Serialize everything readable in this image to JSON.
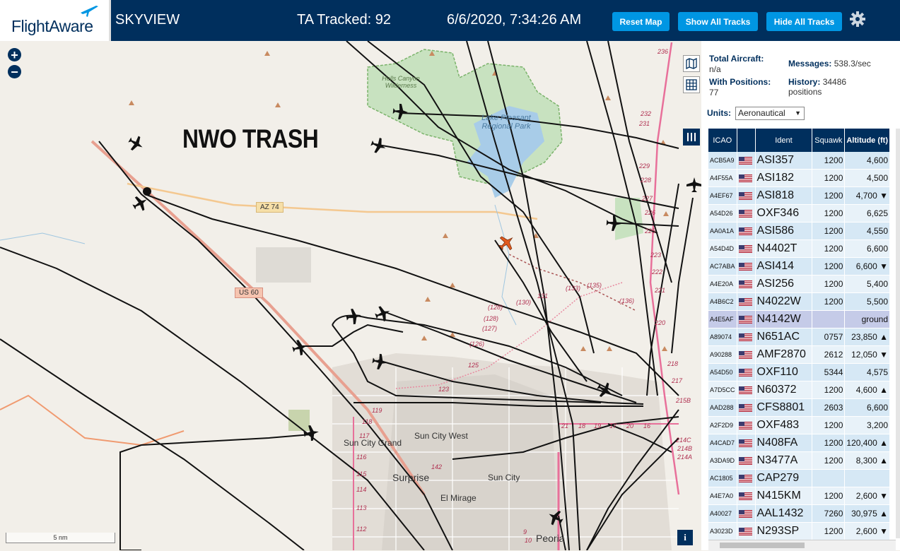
{
  "header": {
    "logo_text": "FlightAware",
    "app_title": "SKYVIEW",
    "tracked_label": "TA Tracked: 92",
    "datetime": "6/6/2020, 7:34:26 AM",
    "buttons": {
      "reset_map": "Reset Map",
      "show_all": "Show All Tracks",
      "hide_all": "Hide All Tracks"
    },
    "colors": {
      "bar": "#002f5d",
      "button": "#0096e3"
    }
  },
  "map": {
    "overlay_text": "NWO TRASH",
    "zoom_in": "+",
    "zoom_out": "−",
    "scale_label": "5 nm",
    "info_button": "i",
    "places": {
      "hells_canyon": "Hells Canyon Wilderness",
      "lake_pleasant": "Lake Pleasant Regional Park",
      "az74": "AZ 74",
      "us60": "US 60",
      "sun_city_grand": "Sun City Grand",
      "sun_city_west": "Sun City West",
      "surprise": "Surprise",
      "sun_city": "Sun City",
      "el_mirage": "El Mirage",
      "peoria": "Peoria"
    },
    "route_labels": {
      "r236": "236",
      "r232": "232",
      "r231": "231",
      "r229": "229",
      "r228": "228",
      "r227": "227",
      "r226": "226",
      "r225": "225",
      "r223": "223",
      "r222": "222",
      "r221": "221",
      "r220": "220",
      "r218": "218",
      "r217": "217",
      "r215b": "215B",
      "r214c": "214C",
      "r214b": "214B",
      "r214a": "214A",
      "r136": "(136)",
      "r135": "(135)",
      "r133": "(133)",
      "r131": "131",
      "r130": "(130)",
      "r128a": "(128)",
      "r128b": "(128)",
      "r127": "(127)",
      "r126": "(126)",
      "r125": "125",
      "r123": "123",
      "r119": "119",
      "r118": "118",
      "r117": "117",
      "r116": "116",
      "r115": "115",
      "r114": "114",
      "r113": "113",
      "r112": "112",
      "s21": "21",
      "s20": "20",
      "s19": "19",
      "s18": "18",
      "s17": "17",
      "s16": "16",
      "r142": "142",
      "s9": "9",
      "s10": "10"
    },
    "tool_icons": [
      "map-icon",
      "grid-icon",
      "columns-icon"
    ]
  },
  "panel": {
    "total_aircraft_label": "Total Aircraft:",
    "total_aircraft_value": "n/a",
    "messages_label": "Messages:",
    "messages_value": "538.3/sec",
    "with_positions_label": "With Positions:",
    "with_positions_value": "77",
    "history_label": "History:",
    "history_value": "34486 positions",
    "units_label": "Units:",
    "units_value": "Aeronautical",
    "columns": [
      "ICAO",
      "",
      "Ident",
      "Squawk",
      "Altitude (ft)"
    ],
    "rows": [
      {
        "icao": "ACB5A9",
        "ident": "ASI357",
        "squawk": "1200",
        "altitude": "4,600"
      },
      {
        "icao": "A4F55A",
        "ident": "ASI182",
        "squawk": "1200",
        "altitude": "4,500"
      },
      {
        "icao": "A4EF67",
        "ident": "ASI818",
        "squawk": "1200",
        "altitude": "4,700 ▼"
      },
      {
        "icao": "A54D26",
        "ident": "OXF346",
        "squawk": "1200",
        "altitude": "6,625"
      },
      {
        "icao": "AA0A1A",
        "ident": "ASI586",
        "squawk": "1200",
        "altitude": "4,550"
      },
      {
        "icao": "A54D4D",
        "ident": "N4402T",
        "squawk": "1200",
        "altitude": "6,600"
      },
      {
        "icao": "AC7ABA",
        "ident": "ASI414",
        "squawk": "1200",
        "altitude": "6,600 ▼"
      },
      {
        "icao": "A4E20A",
        "ident": "ASI256",
        "squawk": "1200",
        "altitude": "5,400"
      },
      {
        "icao": "A4B6C2",
        "ident": "N4022W",
        "squawk": "1200",
        "altitude": "5,500"
      },
      {
        "icao": "A4E5AF",
        "ident": "N4142W",
        "squawk": "",
        "altitude": "ground"
      },
      {
        "icao": "A89074",
        "ident": "N651AC",
        "squawk": "0757",
        "altitude": "23,850 ▲"
      },
      {
        "icao": "A90288",
        "ident": "AMF2870",
        "squawk": "2612",
        "altitude": "12,050 ▼"
      },
      {
        "icao": "A54D50",
        "ident": "OXF110",
        "squawk": "5344",
        "altitude": "4,575"
      },
      {
        "icao": "A7D5CC",
        "ident": "N60372",
        "squawk": "1200",
        "altitude": "4,600 ▲"
      },
      {
        "icao": "AAD288",
        "ident": "CFS8801",
        "squawk": "2603",
        "altitude": "6,600"
      },
      {
        "icao": "A2F2D9",
        "ident": "OXF483",
        "squawk": "1200",
        "altitude": "3,200"
      },
      {
        "icao": "A4CAD7",
        "ident": "N408FA",
        "squawk": "1200",
        "altitude": "120,400 ▲"
      },
      {
        "icao": "A3DA9D",
        "ident": "N3477A",
        "squawk": "1200",
        "altitude": "8,300 ▲"
      },
      {
        "icao": "AC1805",
        "ident": "CAP279",
        "squawk": "",
        "altitude": ""
      },
      {
        "icao": "A4E7A0",
        "ident": "N415KM",
        "squawk": "1200",
        "altitude": "2,600 ▼"
      },
      {
        "icao": "A40027",
        "ident": "AAL1432",
        "squawk": "7260",
        "altitude": "30,975 ▲"
      },
      {
        "icao": "A3023D",
        "ident": "N293SP",
        "squawk": "1200",
        "altitude": "2,600 ▼"
      }
    ],
    "selected_row": 9
  }
}
